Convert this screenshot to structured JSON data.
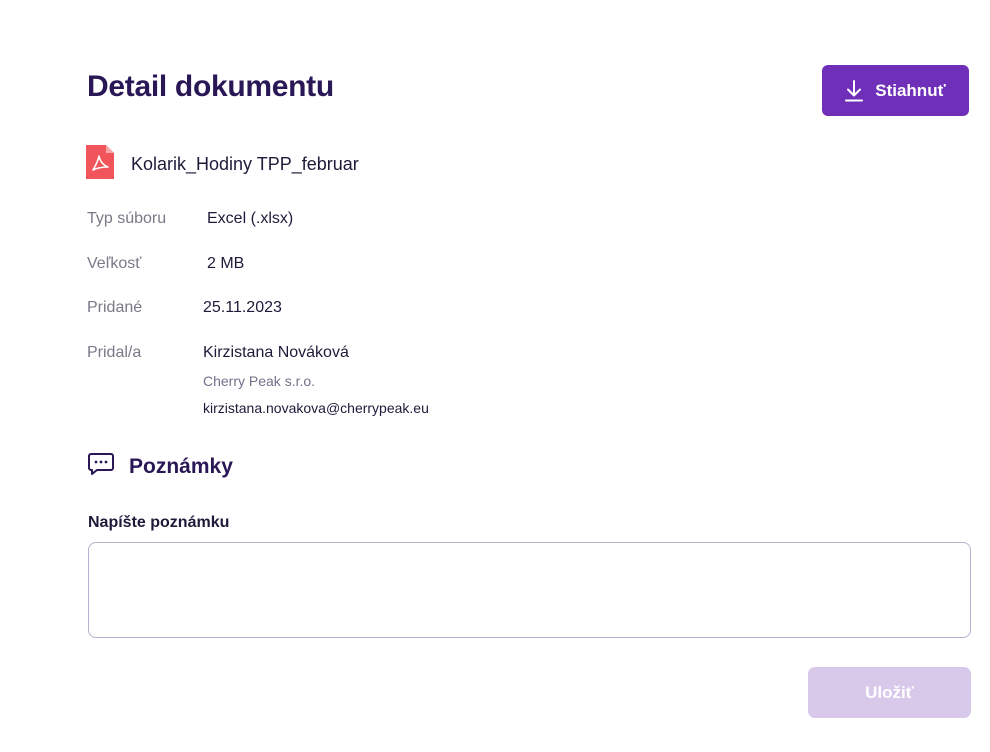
{
  "header": {
    "title": "Detail dokumentu",
    "download_label": "Stiahnuť"
  },
  "file": {
    "name": "Kolarik_Hodiny TPP_februar",
    "icon": "pdf-file-icon"
  },
  "meta": {
    "type_label": "Typ súboru",
    "type_value": "Excel (.xlsx)",
    "size_label": "Veľkosť",
    "size_value": "2 MB",
    "added_label": "Pridané",
    "added_value": "25.11.2023",
    "added_by_label": "Pridal/a",
    "added_by_name": "Kirzistana Nováková",
    "added_by_company": "Cherry Peak s.r.o.",
    "added_by_email": "kirzistana.novakova@cherrypeak.eu"
  },
  "notes": {
    "title": "Poznámky",
    "icon": "chat-bubble-icon",
    "field_label": "Napíšte poznámku",
    "field_value": "",
    "save_label": "Uložiť"
  },
  "colors": {
    "primary": "#6f2fb8",
    "primary_disabled": "#d8c8ea",
    "heading": "#2a1755",
    "pdf_red": "#f2545b"
  }
}
